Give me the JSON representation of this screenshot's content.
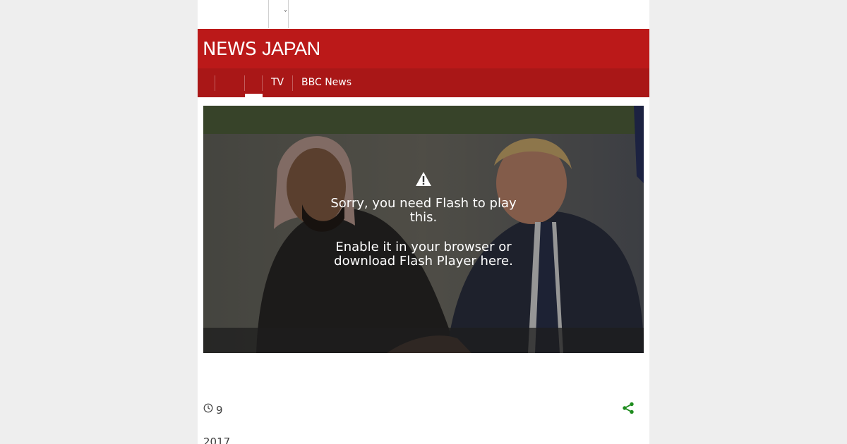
{
  "topbar": {
    "caret": "˅"
  },
  "masthead": {
    "brand_bold": "NEWS",
    "brand_light": "JAPAN",
    "background": "#bb1919"
  },
  "nav": {
    "items": [
      {
        "label": ""
      },
      {
        "label": ""
      },
      {
        "label": "",
        "active": true
      },
      {
        "label": "TV"
      },
      {
        "label": "BBC News"
      }
    ]
  },
  "media": {
    "icon": "warning-icon",
    "message_line1": "Sorry, you need Flash to play this.",
    "message_line2": "Enable it in your browser or download Flash Player here."
  },
  "article_meta": {
    "icon": "clock-icon",
    "date_day": "9",
    "date_year": "2017",
    "share_icon": "share-icon",
    "share_color": "#1e8c1e"
  }
}
